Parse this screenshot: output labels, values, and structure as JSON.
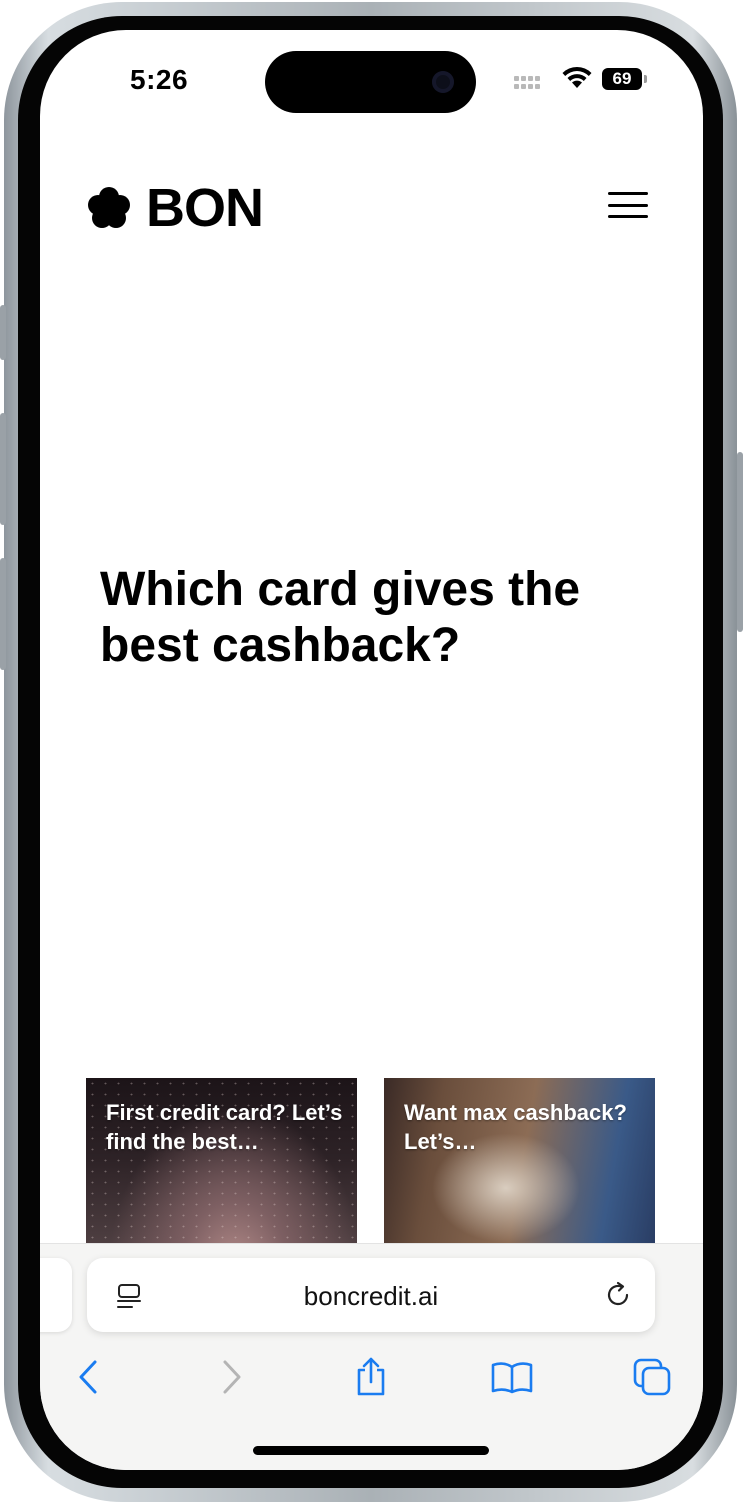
{
  "status_bar": {
    "time": "5:26",
    "battery": "69"
  },
  "header": {
    "brand": "BON",
    "logo_icon": "flower-logo-icon",
    "menu_icon": "hamburger-menu-icon"
  },
  "hero": {
    "title": "Which card gives the best cashback?"
  },
  "cards": [
    {
      "title": "First credit card? Let’s find the best…"
    },
    {
      "title": "Want max cashback? Let’s…"
    }
  ],
  "browser": {
    "url": "boncredit.ai",
    "page_menu_icon": "page-menu-icon",
    "reload_icon": "reload-icon"
  },
  "toolbar": {
    "icons": [
      "back-icon",
      "forward-icon",
      "share-icon",
      "bookmarks-icon",
      "tabs-icon"
    ]
  },
  "colors": {
    "accent": "#1a7cf0",
    "disabled": "#b4b4b4",
    "text": "#000000"
  }
}
